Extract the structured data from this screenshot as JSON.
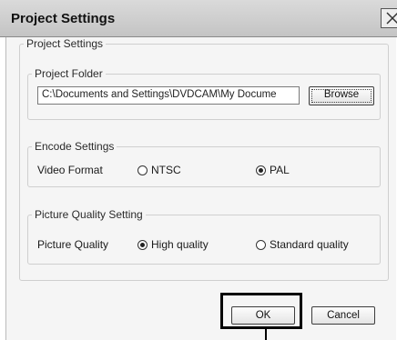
{
  "dialog": {
    "title": "Project Settings",
    "close_icon": "close-x-icon",
    "main_group_label": "Project Settings"
  },
  "project_folder": {
    "group_label": "Project Folder",
    "path_value": "C:\\Documents and Settings\\DVDCAM\\My Docume",
    "browse_label": "Browse"
  },
  "encode_settings": {
    "group_label": "Encode Settings",
    "field_label": "Video Format",
    "options": [
      {
        "label": "NTSC",
        "selected": false
      },
      {
        "label": "PAL",
        "selected": true
      }
    ]
  },
  "picture_quality": {
    "group_label": "Picture Quality Setting",
    "field_label": "Picture Quality",
    "options": [
      {
        "label": "High quality",
        "selected": true
      },
      {
        "label": "Standard quality",
        "selected": false
      }
    ]
  },
  "footer": {
    "ok_label": "OK",
    "cancel_label": "Cancel"
  },
  "colors": {
    "title_bar": "#cfcfcf",
    "client_bg": "#f5f5f5",
    "highlight": "#000000"
  }
}
